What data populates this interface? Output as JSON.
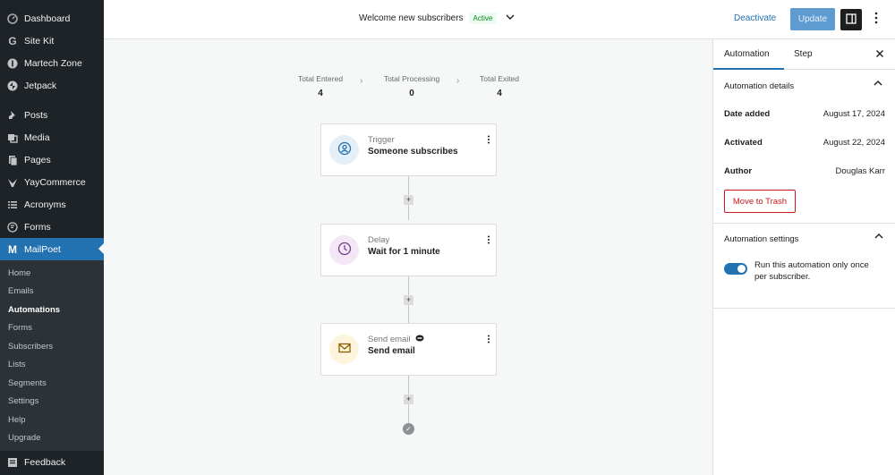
{
  "sidebar": {
    "top_items": [
      {
        "label": "Dashboard",
        "icon": "dashboard-icon"
      },
      {
        "label": "Site Kit",
        "icon": "site-kit-icon"
      },
      {
        "label": "Martech Zone",
        "icon": "info-icon"
      },
      {
        "label": "Jetpack",
        "icon": "jetpack-icon"
      }
    ],
    "items": [
      {
        "label": "Posts",
        "icon": "pin-icon"
      },
      {
        "label": "Media",
        "icon": "media-icon"
      },
      {
        "label": "Pages",
        "icon": "pages-icon"
      },
      {
        "label": "YayCommerce",
        "icon": "yay-icon"
      },
      {
        "label": "Acronyms",
        "icon": "list-icon"
      },
      {
        "label": "Forms",
        "icon": "forms-icon"
      }
    ],
    "active": {
      "label": "MailPoet",
      "icon": "mailpoet-icon"
    },
    "submenu": [
      "Home",
      "Emails",
      "Automations",
      "Forms",
      "Subscribers",
      "Lists",
      "Segments",
      "Settings",
      "Help",
      "Upgrade"
    ],
    "current_submenu": "Automations",
    "feedback": {
      "label": "Feedback",
      "icon": "feedback-icon"
    }
  },
  "header": {
    "title": "Welcome new subscribers",
    "status": "Active",
    "deactivate_label": "Deactivate",
    "update_label": "Update"
  },
  "stats": [
    {
      "label": "Total Entered",
      "value": "4"
    },
    {
      "label": "Total Processing",
      "value": "0"
    },
    {
      "label": "Total Exited",
      "value": "4"
    }
  ],
  "steps": [
    {
      "type": "Trigger",
      "name": "Someone subscribes",
      "icon": "user-circle-icon",
      "color": "#e5eff7"
    },
    {
      "type": "Delay",
      "name": "Wait for 1 minute",
      "icon": "clock-icon",
      "color": "#f3e6f5"
    },
    {
      "type": "Send email",
      "name": "Send email",
      "icon": "envelope-icon",
      "color": "#fdf4dd"
    }
  ],
  "panel": {
    "tabs": [
      "Automation",
      "Step"
    ],
    "details_title": "Automation details",
    "details": [
      {
        "key": "Date added",
        "value": "August 17, 2024"
      },
      {
        "key": "Activated",
        "value": "August 22, 2024"
      },
      {
        "key": "Author",
        "value": "Douglas Karr"
      }
    ],
    "trash_label": "Move to Trash",
    "settings_title": "Automation settings",
    "toggle_label": "Run this automation only once per subscriber.",
    "toggle_on": true
  },
  "colors": {
    "accent": "#2271b1",
    "sidebar_bg": "#1d2327",
    "danger": "#cc1818",
    "active_badge": "#008a20"
  }
}
